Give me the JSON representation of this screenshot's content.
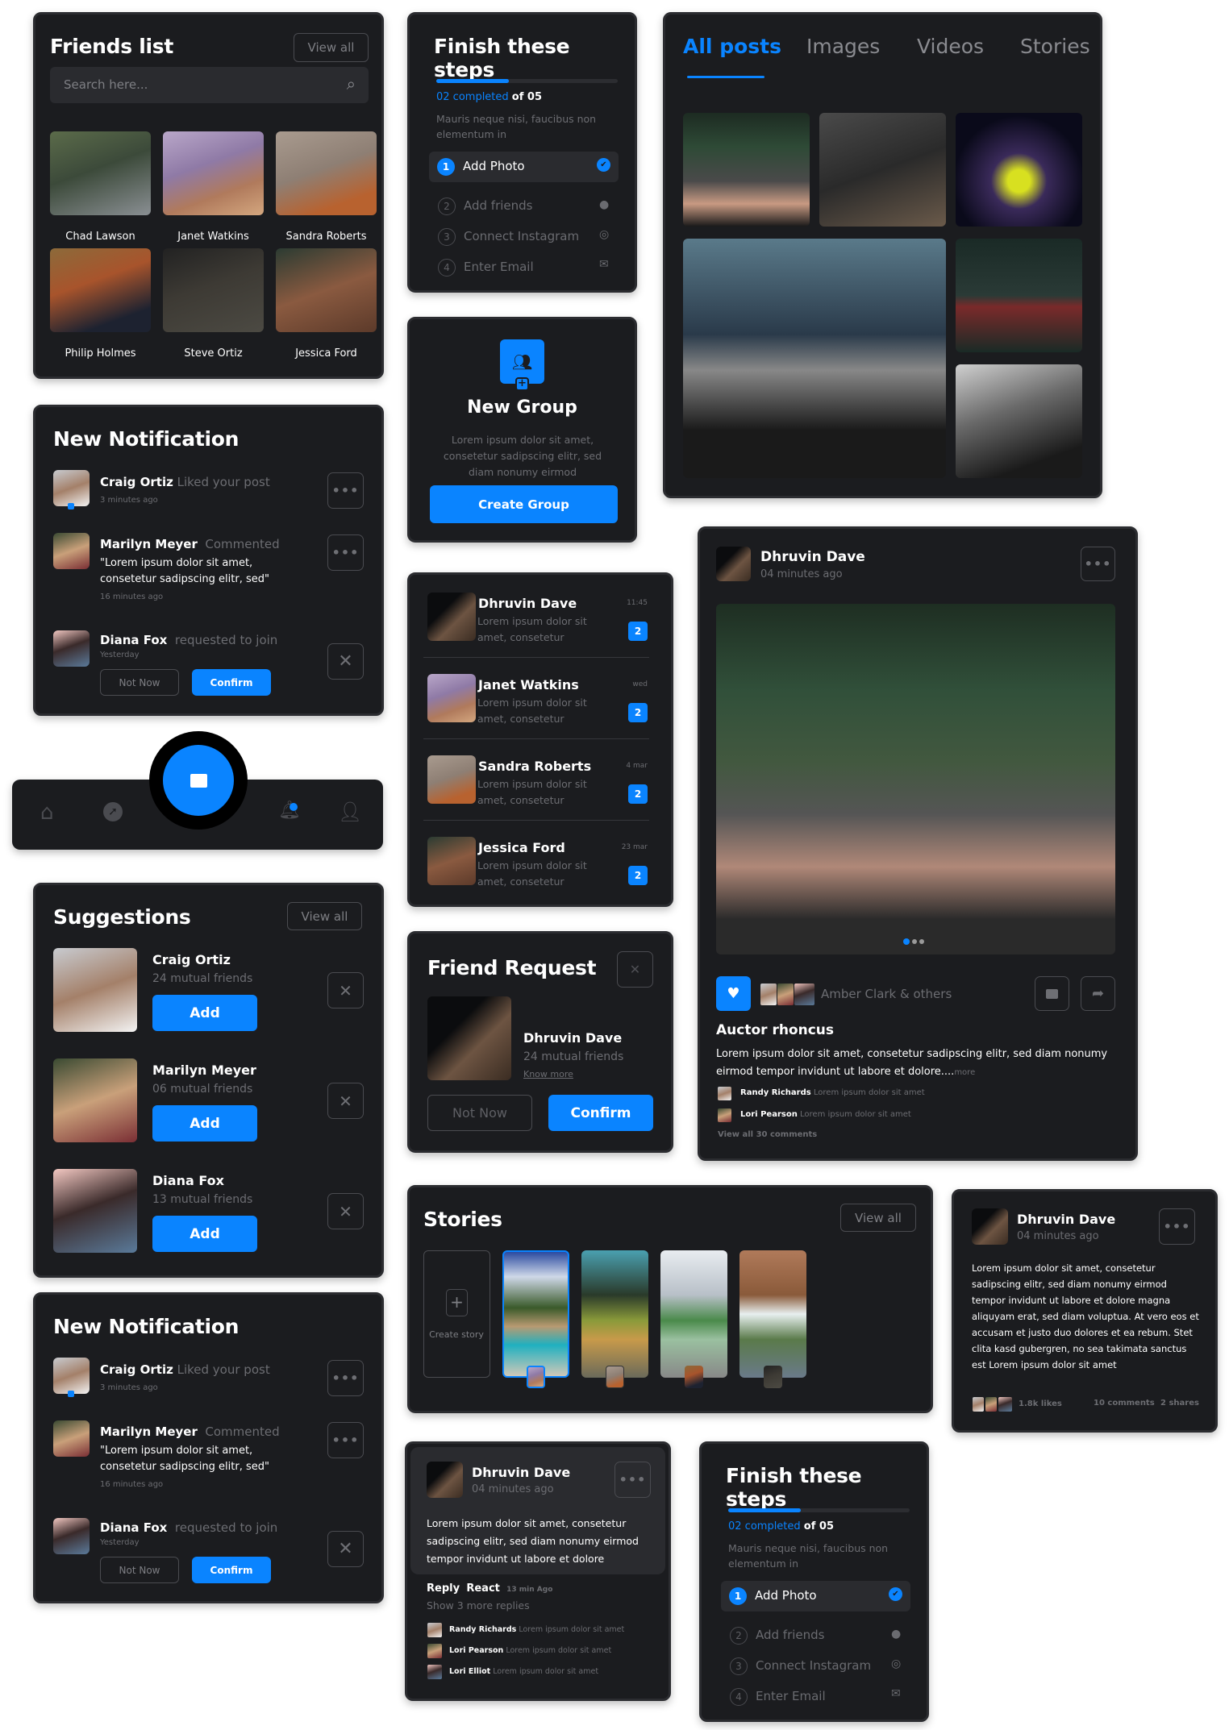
{
  "colors": {
    "accent": "#0a84ff",
    "card_bg": "#1b1c1f",
    "muted": "#6c6d72"
  },
  "friends_list": {
    "title": "Friends list",
    "view_all": "View all",
    "search_placeholder": "Search here...",
    "friends": [
      "Chad Lawson",
      "Janet Watkins",
      "Sandra Roberts",
      "Philip Holmes",
      "Steve Ortiz",
      "Jessica Ford"
    ]
  },
  "steps": {
    "title": "Finish these steps",
    "progress_fraction": 0.4,
    "completed_text": "02 completed",
    "of_text": "of 05",
    "description": "Mauris neque nisi, faucibus non elementum in",
    "items": [
      {
        "num": "1",
        "label": "Add Photo",
        "icon": "check-circle-icon",
        "glyph": "✔",
        "active": true
      },
      {
        "num": "2",
        "label": "Add friends",
        "icon": "user-circle-icon",
        "glyph": "●"
      },
      {
        "num": "3",
        "label": "Connect Instagram",
        "icon": "instagram-icon",
        "glyph": "◎"
      },
      {
        "num": "4",
        "label": "Enter Email",
        "icon": "envelope-icon",
        "glyph": "✉"
      }
    ]
  },
  "posts_tabs": {
    "tabs": [
      "All posts",
      "Images",
      "Videos",
      "Stories"
    ],
    "active": 0
  },
  "new_group": {
    "title": "New Group",
    "description": "Lorem ipsum dolor sit amet, consetetur sadipscing elitr, sed diam nonumy eirmod",
    "button": "Create Group"
  },
  "notification": {
    "title": "New Notification",
    "items": [
      {
        "name": "Craig Ortiz",
        "action": "Liked your post",
        "time": "3 minutes ago"
      },
      {
        "name": "Marilyn Meyer",
        "action": "Commented",
        "comment": "\"Lorem ipsum dolor sit amet, consetetur sadipscing elitr, sed\"",
        "time": "16 minutes ago"
      },
      {
        "name": "Diana Fox",
        "action": "requested to join",
        "time": "Yesterday",
        "not_now": "Not Now",
        "confirm": "Confirm"
      }
    ]
  },
  "bottom_nav": {
    "items": [
      "home-icon",
      "compass-icon",
      "chat-icon",
      "bell-icon",
      "user-icon"
    ]
  },
  "messages": {
    "items": [
      {
        "name": "Dhruvin Dave",
        "preview": "Lorem ipsum dolor sit amet, consetetur",
        "time": "11:45",
        "count": "2"
      },
      {
        "name": "Janet Watkins",
        "preview": "Lorem ipsum dolor sit amet, consetetur",
        "time": "wed",
        "count": "2"
      },
      {
        "name": "Sandra Roberts",
        "preview": "Lorem ipsum dolor sit amet, consetetur",
        "time": "4 mar",
        "count": "2"
      },
      {
        "name": "Jessica Ford",
        "preview": "Lorem ipsum dolor sit amet, consetetur",
        "time": "23 mar",
        "count": "2"
      }
    ]
  },
  "post": {
    "author": "Dhruvin Dave",
    "time": "04 minutes ago",
    "likers_text": "Amber Clark & others",
    "title": "Auctor rhoncus",
    "body": "Lorem ipsum dolor sit amet, consetetur sadipscing elitr, sed diam nonumy eirmod tempor invidunt ut labore et dolore....",
    "more": "more",
    "comments": [
      {
        "name": "Randy Richards",
        "text": "Lorem ipsum dolor sit amet"
      },
      {
        "name": "Lori Pearson",
        "text": "Lorem ipsum dolor sit amet"
      }
    ],
    "view_all": "View all 30 comments"
  },
  "suggestions": {
    "title": "Suggestions",
    "view_all": "View all",
    "items": [
      {
        "name": "Craig Ortiz",
        "mutual": "24 mutual friends",
        "button": "Add"
      },
      {
        "name": "Marilyn Meyer",
        "mutual": "06 mutual friends",
        "button": "Add"
      },
      {
        "name": "Diana Fox",
        "mutual": "13 mutual friends",
        "button": "Add"
      }
    ]
  },
  "friend_request": {
    "title": "Friend Request",
    "name": "Dhruvin Dave",
    "mutual": "24 mutual friends",
    "know_more": "Know more",
    "not_now": "Not Now",
    "confirm": "Confirm"
  },
  "stories": {
    "title": "Stories",
    "view_all": "View all",
    "create": "Create story"
  },
  "text_post": {
    "author": "Dhruvin Dave",
    "time": "04 minutes ago",
    "body": "Lorem ipsum dolor sit amet, consetetur sadipscing elitr, sed diam nonumy eirmod tempor invidunt ut labore et dolore magna aliquyam erat, sed diam voluptua. At vero eos et accusam et justo duo dolores et ea rebum. Stet clita kasd gubergren, no sea takimata sanctus est Lorem ipsum dolor sit amet",
    "likes": "1.8k likes",
    "comments": "10 comments",
    "shares": "2 shares"
  },
  "comment_card": {
    "author": "Dhruvin Dave",
    "time": "04 minutes ago",
    "body": "Lorem ipsum dolor sit amet, consetetur sadipscing elitr, sed diam nonumy eirmod tempor invidunt ut labore et dolore",
    "reply": "Reply",
    "react": "React",
    "ago": "13 min Ago",
    "show_more": "Show 3 more replies",
    "replies": [
      {
        "name": "Randy Richards",
        "text": "Lorem ipsum dolor sit amet"
      },
      {
        "name": "Lori Pearson",
        "text": "Lorem ipsum dolor sit amet"
      },
      {
        "name": "Lori Elliot",
        "text": "Lorem ipsum dolor sit amet"
      }
    ]
  }
}
